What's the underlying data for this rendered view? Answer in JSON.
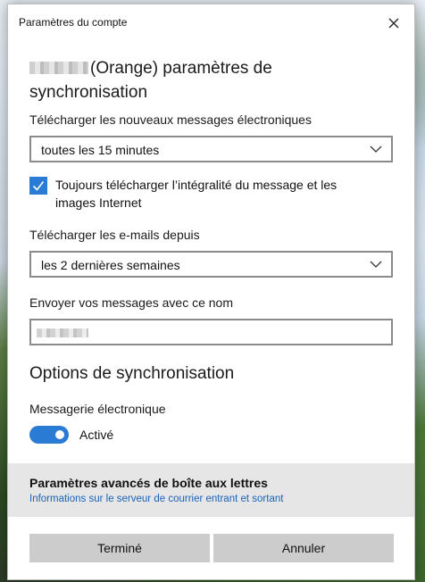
{
  "window": {
    "title": "Paramètres du compte"
  },
  "header": {
    "heading_line1": "(Orange) paramètres de",
    "heading_line2": "synchronisation"
  },
  "download": {
    "label": "Télécharger les nouveaux messages électroniques",
    "selected": "toutes les 15 minutes"
  },
  "full_download": {
    "checked": true,
    "label": "Toujours télécharger l’intégralité du message et les images Internet"
  },
  "since": {
    "label": "Télécharger les e-mails depuis",
    "selected": "les 2 dernières semaines"
  },
  "sender_name": {
    "label": "Envoyer vos messages avec ce nom",
    "value": ""
  },
  "sync_options": {
    "title": "Options de synchronisation",
    "email_label": "Messagerie électronique",
    "toggle_on": true,
    "toggle_state": "Activé"
  },
  "advanced": {
    "title": "Paramètres avancés de boîte aux lettres",
    "link": "Informations sur le serveur de courrier entrant et sortant"
  },
  "buttons": {
    "done": "Terminé",
    "cancel": "Annuler"
  },
  "colors": {
    "accent": "#2a7bd4",
    "link": "#1a62b8",
    "button_bg": "#cccccc",
    "advanced_bg": "#e6e6e6"
  }
}
